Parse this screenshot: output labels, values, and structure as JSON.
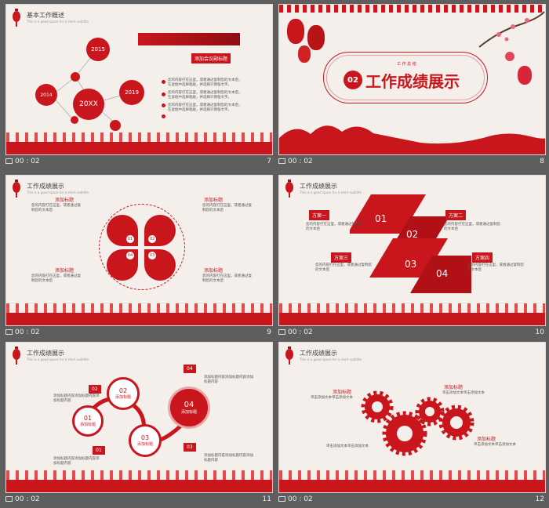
{
  "slides": [
    {
      "num": "7",
      "time": "00 : 02",
      "title": "基本工作概述",
      "subtitle": "This is a good  space for a short subtitle",
      "years": [
        "2015",
        "2014",
        "20XX",
        "2019"
      ],
      "label": "添加会议副标题",
      "bullets": [
        "您的内容打在这里，或者通过复制您的文本后，",
        "在此框中选择粘贴，并选择只保留文字。",
        "您的内容打在这里，或者通过复制您的文本后，",
        "在此框中选择粘贴，并选择只保留文字。"
      ]
    },
    {
      "num": "8",
      "time": "00 : 02",
      "small": "工 作 总 结",
      "badge": "02",
      "title": "工作成绩展示"
    },
    {
      "num": "9",
      "time": "00 : 02",
      "title": "工作成绩展示",
      "subtitle": "This is a good  space for a short subtitle",
      "labels": [
        "添加标题",
        "添加标题",
        "添加标题",
        "添加标题"
      ],
      "nums": [
        "01",
        "02",
        "03",
        "04"
      ],
      "text": "您的内容打在这里，或者通过复制您的文本后"
    },
    {
      "num": "10",
      "time": "00 : 02",
      "title": "工作成绩展示",
      "subtitle": "This is a good  space for a short subtitle",
      "plans": [
        "方案一",
        "方案二",
        "方案三",
        "方案四"
      ],
      "nums": [
        "01",
        "02",
        "03",
        "04"
      ],
      "text": "您的内容打在这里，或者通过复制您的文本后"
    },
    {
      "num": "11",
      "time": "00 : 02",
      "title": "工作成绩展示",
      "subtitle": "This is a good  space for a short subtitle",
      "nums": [
        "01",
        "02",
        "03",
        "04"
      ],
      "label": "添加标题",
      "text": "添加标题内容添加标题内容添加标题内容"
    },
    {
      "num": "12",
      "time": "00 : 02",
      "title": "工作成绩展示",
      "subtitle": "This is a good  space for a short subtitle",
      "label": "添加标题",
      "text": "单击添加文本单击添加文本"
    }
  ]
}
